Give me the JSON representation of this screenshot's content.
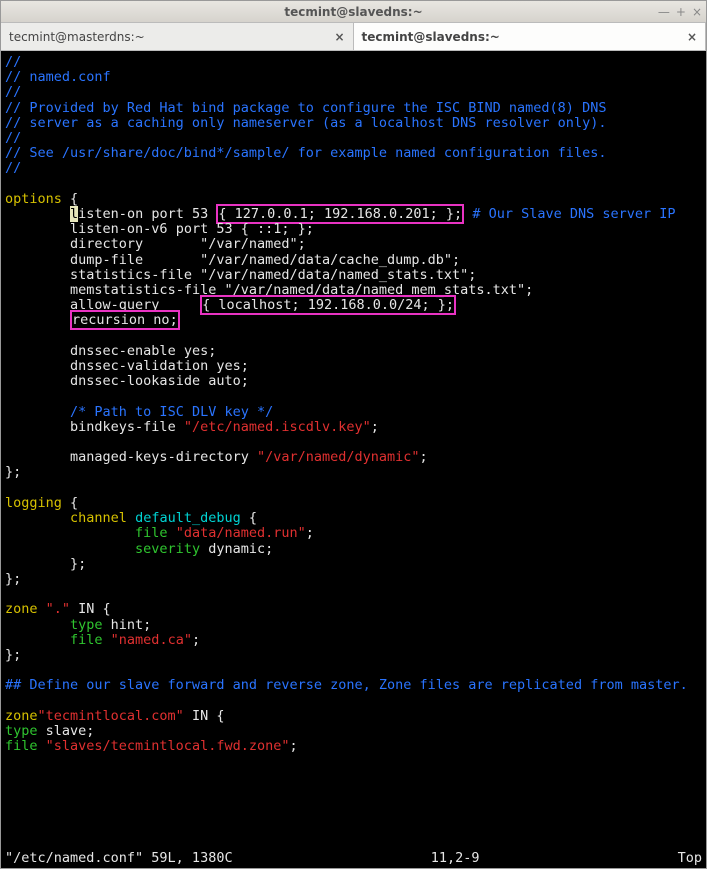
{
  "window": {
    "title": "tecmint@slavedns:~"
  },
  "tabs": [
    {
      "label": "tecmint@masterdns:~"
    },
    {
      "label": "tecmint@slavedns:~"
    }
  ],
  "file": {
    "header": {
      "l1": "//",
      "l2": "// named.conf",
      "l3": "//",
      "l4": "// Provided by Red Hat bind package to configure the ISC BIND named(8) DNS",
      "l5": "// server as a caching only nameserver (as a localhost DNS resolver only).",
      "l6": "//",
      "l7": "// See /usr/share/doc/bind*/sample/ for example named configuration files.",
      "l8": "//"
    },
    "options": {
      "kw": "options",
      "listen_on": {
        "prefix": "isten-on port 53 ",
        "highlight": "{ 127.0.0.1; 192.168.0.201; };",
        "suffix": " # Our Slave DNS server IP"
      },
      "listen_v6": "listen-on-v6 port 53 { ::1; };",
      "directory": "directory       \"/var/named\";",
      "dump_file": "dump-file       \"/var/named/data/cache_dump.db\";",
      "stats_file": "statistics-file \"/var/named/data/named_stats.txt\";",
      "memstats_file": "memstatistics-file \"/var/named/data/named_mem_stats.txt\";",
      "allow_query": {
        "label": "allow-query     ",
        "highlight": "{ localhost; 192.168.0.0/24; };"
      },
      "recursion": "recursion no;",
      "dnssec_enable": "dnssec-enable yes;",
      "dnssec_valid": "dnssec-validation yes;",
      "dnssec_look": "dnssec-lookaside auto;",
      "path_comment": "/* Path to ISC DLV key */",
      "bindkeys": {
        "label": "bindkeys-file ",
        "value": "\"/etc/named.iscdlv.key\"",
        "tail": ";"
      },
      "managed_keys": {
        "label": "managed-keys-directory ",
        "value": "\"/var/named/dynamic\"",
        "tail": ";"
      }
    },
    "logging": {
      "kw": "logging",
      "channel_kw": "channel",
      "channel_name": " default_debug ",
      "file_kw": "file ",
      "file_val": "\"data/named.run\"",
      "severity_kw": "severity",
      "severity_val": " dynamic;"
    },
    "zone_root": {
      "decl": {
        "kw": "zone ",
        "name": "\".\"",
        "in": " IN {"
      },
      "type": {
        "kw": "type",
        "val": " hint;"
      },
      "file": {
        "kw": "file ",
        "val": "\"named.ca\"",
        "tail": ";"
      }
    },
    "slave_comment": "## Define our slave forward and reverse zone, Zone files are replicated from master.",
    "zone_slave": {
      "decl": {
        "kw": "zone",
        "name": "\"tecmintlocal.com\"",
        "in": " IN {"
      },
      "type": {
        "kw": "type",
        "val": " slave;"
      },
      "file": {
        "kw": "file ",
        "val": "\"slaves/tecmintlocal.fwd.zone\"",
        "tail": ";"
      }
    }
  },
  "status": {
    "left": "\"/etc/named.conf\" 59L, 1380C",
    "mid": "11,2-9",
    "right": "Top"
  }
}
